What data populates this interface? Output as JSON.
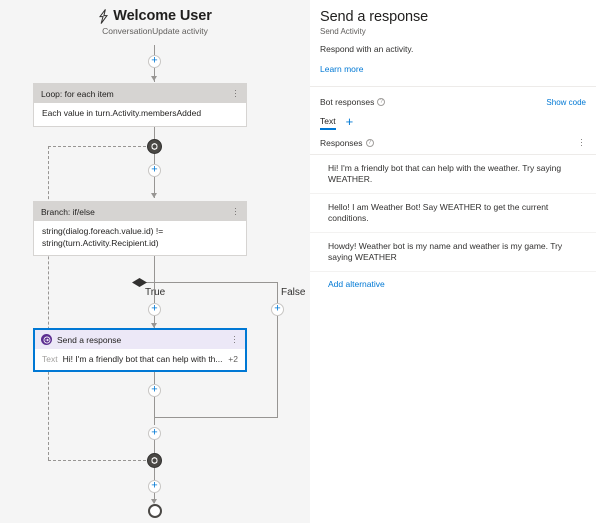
{
  "canvas": {
    "title": "Welcome User",
    "subtitle": "ConversationUpdate activity",
    "bolt_icon": "lightning-bolt-icon",
    "nodes": {
      "loop": {
        "header": "Loop: for each item",
        "body": "Each value in turn.Activity.membersAdded",
        "menu_icon": "kebab-menu-icon"
      },
      "branch": {
        "header": "Branch: if/else",
        "body_line1": "string(dialog.foreach.value.id) !=",
        "body_line2": "string(turn.Activity.Recipient.id)",
        "menu_icon": "kebab-menu-icon"
      },
      "send": {
        "header": "Send a response",
        "icon": "send-response-icon",
        "field_key": "Text",
        "field_value": "Hi! I'm a friendly bot that can help with th...",
        "more_count": "+2",
        "menu_icon": "kebab-menu-icon"
      }
    },
    "branch_labels": {
      "true": "True",
      "false": "False"
    },
    "add_icon": "plus-icon",
    "loop_icon": "loop-arrows-icon",
    "end_icon": "end-node-icon",
    "colors": {
      "canvas_bg": "#f5f5f5",
      "selected_border": "#0078d4",
      "send_accent": "#5c2e91",
      "card_header": "#d6d4d2"
    }
  },
  "panel": {
    "title": "Send a response",
    "subtitle": "Send Activity",
    "description": "Respond with an activity.",
    "learn_more": "Learn more",
    "bot_responses_label": "Bot responses",
    "show_code": "Show code",
    "info_icon": "info-circle-icon",
    "tabs": [
      {
        "label": "Text",
        "active": true
      }
    ],
    "add_tab_icon": "plus-icon",
    "responses_label": "Responses",
    "responses_menu_icon": "kebab-menu-icon",
    "responses": [
      "Hi! I'm a friendly bot that can help with the weather. Try saying WEATHER.",
      "Hello! I am Weather Bot! Say WEATHER to get the current conditions.",
      "Howdy! Weather bot is my name and weather is my game. Try saying WEATHER"
    ],
    "add_alternative": "Add alternative",
    "colors": {
      "link": "#0078d4",
      "accent": "#0078d4"
    }
  }
}
